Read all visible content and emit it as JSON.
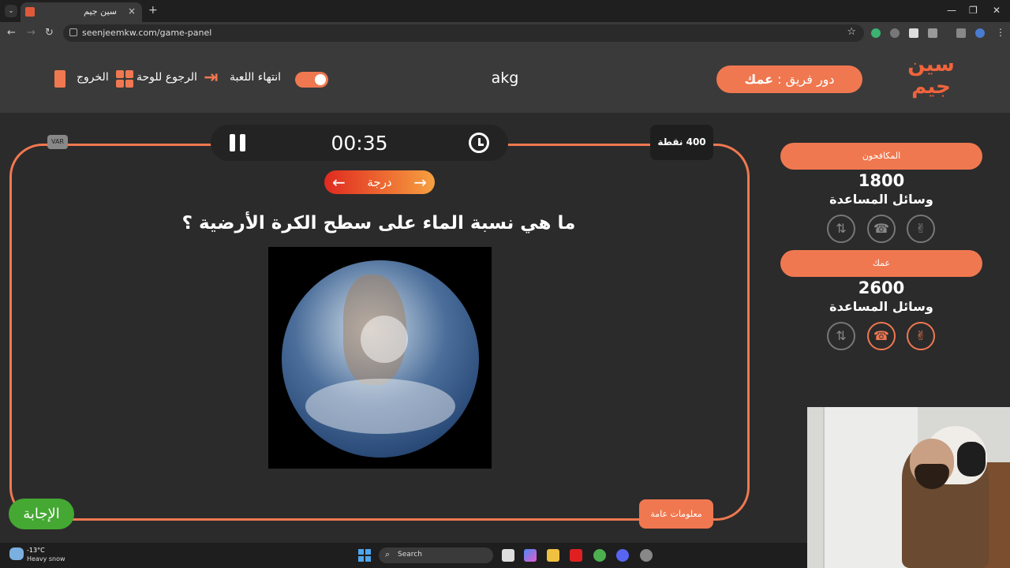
{
  "browser": {
    "tab_title": "سين جيم",
    "tab_close": "×",
    "new_tab": "+",
    "url": "seenjeemkw.com/game-panel",
    "window_minimize": "—",
    "window_restore": "❐",
    "window_close": "✕"
  },
  "header": {
    "logo_text": "سين جيم",
    "turn_label": "دور فريق : ",
    "turn_team": "عمك",
    "game_name": "akg",
    "end_game_label": "انتهاء اللعبة",
    "back_to_board_label": "الرجوع للوحة",
    "exit_label": "الخروج"
  },
  "question_panel": {
    "timer": "00:35",
    "var_label": "VAR",
    "points": "400 نقطة",
    "degree_label": "درجة",
    "question": "ما هي نسبة الماء على سطح الكرة الأرضية ؟",
    "category": "معلومات عامة",
    "answer_button": "الإجابة"
  },
  "teams": [
    {
      "name": "المكافحون",
      "score": "1800",
      "helpers_label": "وسائل المساعدة",
      "aids": [
        {
          "icon": "double-answer-icon",
          "glyph": "✌",
          "active": false
        },
        {
          "icon": "phone-icon",
          "glyph": "☎",
          "active": false
        },
        {
          "icon": "swap-icon",
          "glyph": "⇅",
          "active": false
        }
      ]
    },
    {
      "name": "عمك",
      "score": "2600",
      "helpers_label": "وسائل المساعدة",
      "aids": [
        {
          "icon": "double-answer-icon",
          "glyph": "✌",
          "active": true
        },
        {
          "icon": "phone-icon",
          "glyph": "☎",
          "active": true
        },
        {
          "icon": "swap-icon",
          "glyph": "⇅",
          "active": false
        }
      ]
    }
  ],
  "taskbar": {
    "weather_temp": "-13°C",
    "weather_desc": "Heavy snow",
    "search_placeholder": "Search"
  },
  "colors": {
    "accent": "#f07850",
    "answer_green": "#44a832",
    "page_bg": "#2b2b2b",
    "header_bg": "#3a3a3a"
  }
}
